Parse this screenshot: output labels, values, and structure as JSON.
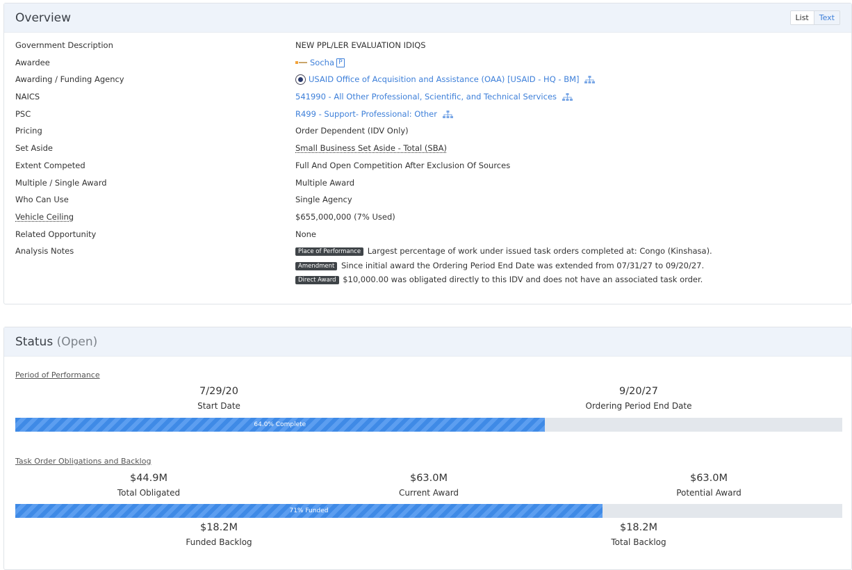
{
  "overview": {
    "title": "Overview",
    "view_toggle": {
      "list": "List",
      "text": "Text"
    },
    "fields": [
      {
        "label": "Government Description",
        "value": "NEW PPL/LER EVALUATION IDIQS"
      },
      {
        "label": "Awardee",
        "value": "Socha"
      },
      {
        "label": "Awarding / Funding Agency",
        "value": "USAID Office of Acquisition and Assistance (OAA) [USAID - HQ - BM]"
      },
      {
        "label": "NAICS",
        "value": "541990 - All Other Professional, Scientific, and Technical Services"
      },
      {
        "label": "PSC",
        "value": "R499 - Support- Professional: Other"
      },
      {
        "label": "Pricing",
        "value": "Order Dependent (IDV Only)"
      },
      {
        "label": "Set Aside",
        "value": "Small Business Set Aside - Total (SBA)"
      },
      {
        "label": "Extent Competed",
        "value": "Full And Open Competition After Exclusion Of Sources"
      },
      {
        "label": "Multiple / Single Award",
        "value": "Multiple Award"
      },
      {
        "label": "Who Can Use",
        "value": "Single Agency"
      },
      {
        "label": "Vehicle Ceiling",
        "value": "$655,000,000 (7% Used)"
      },
      {
        "label": "Related Opportunity",
        "value": "None"
      },
      {
        "label": "Analysis Notes"
      }
    ],
    "awardee_badge": "P",
    "notes": [
      {
        "badge": "Place of Performance",
        "text": "Largest percentage of work under issued task orders completed at: Congo (Kinshasa)."
      },
      {
        "badge": "Amendment",
        "text": "Since initial award the Ordering Period End Date was extended from 07/31/27 to 09/20/27."
      },
      {
        "badge": "Direct Award",
        "text": "$10,000.00 was obligated directly to this IDV and does not have an associated task order."
      }
    ]
  },
  "status": {
    "title": "Status",
    "state": "(Open)",
    "period": {
      "link": "Period of Performance",
      "start_value": "7/29/20",
      "start_label": "Start Date",
      "end_value": "9/20/27",
      "end_label": "Ordering Period End Date",
      "progress_percent": 64.0,
      "progress_label": "64.0% Complete"
    },
    "obligations": {
      "link": "Task Order Obligations and Backlog",
      "total_obligated_value": "$44.9M",
      "total_obligated_label": "Total Obligated",
      "current_award_value": "$63.0M",
      "current_award_label": "Current Award",
      "potential_award_value": "$63.0M",
      "potential_award_label": "Potential Award",
      "funded_percent": 71,
      "funded_label": "71% Funded",
      "funded_backlog_value": "$18.2M",
      "funded_backlog_label": "Funded Backlog",
      "total_backlog_value": "$18.2M",
      "total_backlog_label": "Total Backlog"
    }
  },
  "colors": {
    "accent": "#3d7fd9",
    "header_bg": "#eef3fa",
    "bar_track": "#e3e7ec",
    "badge_bg": "#3f4448"
  }
}
